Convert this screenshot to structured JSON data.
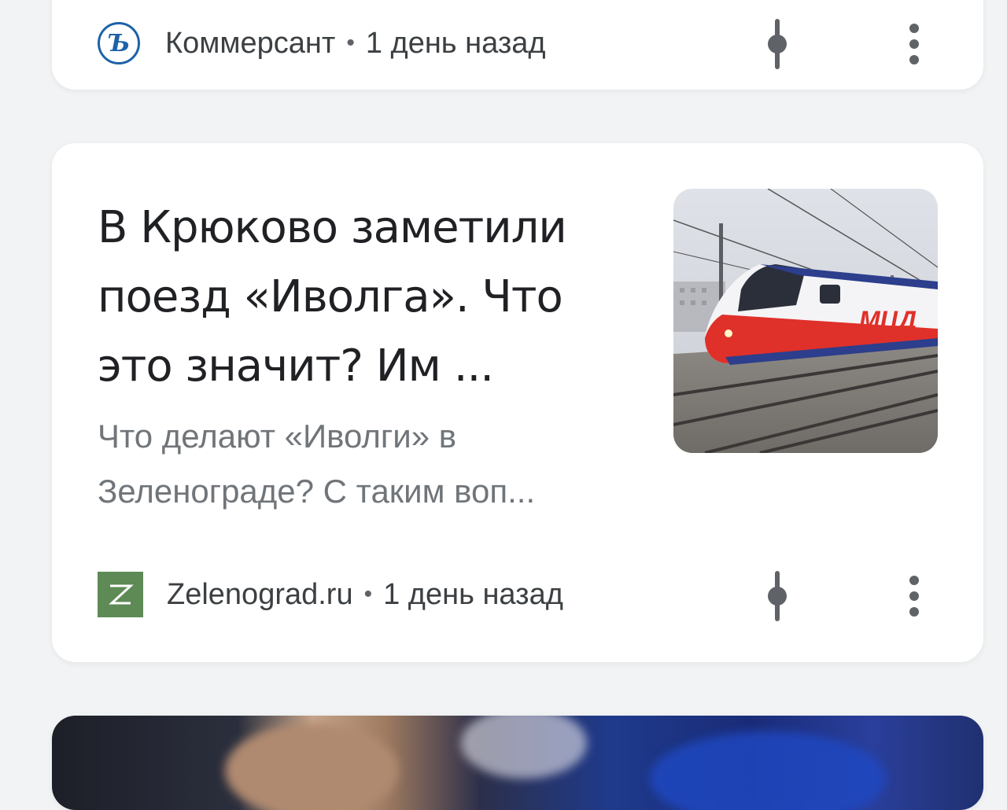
{
  "cards": {
    "top": {
      "source": "Коммерсант",
      "separator": "•",
      "time": "1 день назад",
      "logo_letter": "Ъ"
    },
    "main": {
      "headline": "В Крюково заметили поезд «Иволга». Что это значит? Им ...",
      "snippet": "Что делают «Иволги» в Зеленограде? С таким воп...",
      "source": "Zelenograd.ru",
      "separator": "•",
      "time": "1 день назад",
      "thumbnail_label": "МЦД",
      "logo_letter": "Z"
    }
  },
  "icons": {
    "source_follow": "follow-source-icon",
    "more": "more-vert-icon"
  },
  "colors": {
    "background": "#f1f3f4",
    "card": "#ffffff",
    "headline": "#202124",
    "snippet": "#70757a",
    "kommersant_brand": "#1e62a8",
    "zelenograd_brand": "#5d8a55",
    "train_red": "#e0302a",
    "train_blue": "#2c3e8c"
  }
}
